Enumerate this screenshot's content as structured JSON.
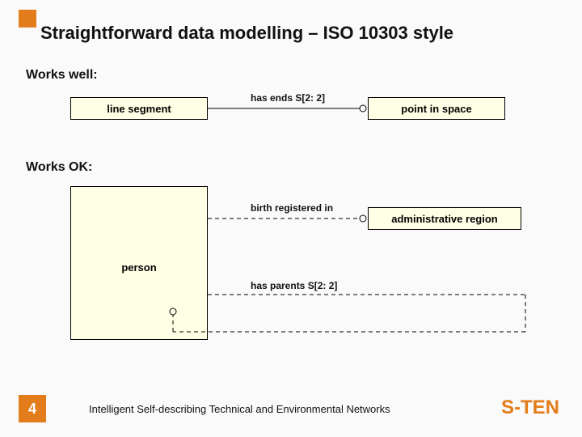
{
  "title": "Straightforward data modelling – ISO 10303 style",
  "sections": {
    "works_well": "Works well:",
    "works_ok": "Works OK:"
  },
  "entities": {
    "line_segment": "line segment",
    "point_in_space": "point in space",
    "person": "person",
    "administrative_region": "administrative region"
  },
  "relations": {
    "has_ends": "has ends S[2: 2]",
    "birth_registered_in": "birth registered in",
    "has_parents": "has parents S[2: 2]"
  },
  "footer": {
    "page_number": "4",
    "tagline": "Intelligent Self-describing Technical and Environmental Networks",
    "brand": "S-TEN"
  },
  "colors": {
    "accent": "#e37c1a",
    "entity_fill": "#feffe4"
  }
}
